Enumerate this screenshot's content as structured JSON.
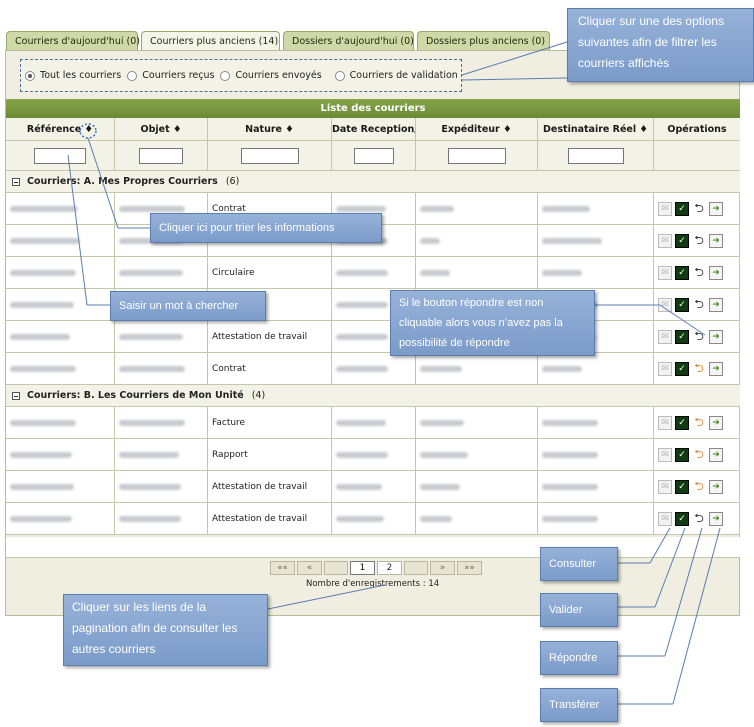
{
  "tabs": [
    "Courriers d'aujourd'hui (0)",
    "Courriers plus anciens (14)",
    "Dossiers d'aujourd'hui (0)",
    "Dossiers plus anciens (0)"
  ],
  "filters": [
    "Tout les courriers",
    "Courriers reçus",
    "Courriers envoyés",
    "Courriers de validation"
  ],
  "table_title": "Liste des courriers",
  "columns": [
    "Référence",
    "Objet",
    "Nature",
    "Date Reception/E",
    "Expéditeur",
    "Destinataire Réel",
    "Opérations"
  ],
  "sort_glyph": "♦",
  "groups": [
    {
      "label": "Courriers: A. Mes Propres Courriers",
      "count": "(6)",
      "natures": [
        "Contrat",
        "",
        "Circulaire",
        "",
        "Attestation de travail",
        "Contrat"
      ]
    },
    {
      "label": "Courriers: B. Les Courriers de Mon Unité",
      "count": "(4)",
      "natures": [
        "Facture",
        "Rapport",
        "Attestation de travail",
        "Attestation de travail"
      ]
    }
  ],
  "pagination": {
    "first": "««",
    "prev": "«",
    "pages": [
      "1",
      "2"
    ],
    "next": "»",
    "last": "»»",
    "records": "Nombre d'enregistrements : 14"
  },
  "callouts": {
    "filter": "Cliquer sur une des options suivantes afin de filtrer les courriers affichés",
    "sort": "Cliquer ici pour trier les informations",
    "search": "Saisir un mot à chercher",
    "reply": "Si le bouton répondre est non cliquable alors vous n’avez pas la possibilité de répondre",
    "pagination": "Cliquer sur les liens de la pagination afin de consulter les autres courriers",
    "consult": "Consulter",
    "validate": "Valider",
    "respond": "Répondre",
    "transfer": "Transférer"
  },
  "colors": {
    "header_green": "#7a9a3f",
    "tab_bg": "#cfd9a8",
    "callout_blue": "#86a3d0"
  }
}
